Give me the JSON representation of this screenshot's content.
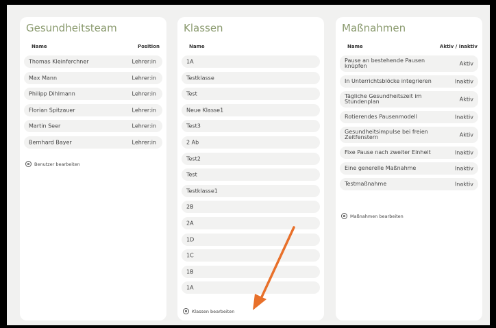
{
  "team": {
    "title": "Gesundheitsteam",
    "col_name": "Name",
    "col_position": "Position",
    "members": [
      {
        "name": "Thomas Kleinferchner",
        "position": "Lehrer:in"
      },
      {
        "name": "Max Mann",
        "position": "Lehrer:in"
      },
      {
        "name": "Philipp Dihlmann",
        "position": "Lehrer:in"
      },
      {
        "name": "Florian Spitzauer",
        "position": "Lehrer:in"
      },
      {
        "name": "Martin Seer",
        "position": "Lehrer:in"
      },
      {
        "name": "Bernhard Bayer",
        "position": "Lehrer:in"
      }
    ],
    "edit_label": "Benutzer bearbeiten"
  },
  "classes": {
    "title": "Klassen",
    "col_name": "Name",
    "items": [
      "1A",
      "Testklasse",
      "Test",
      "Neue Klasse1",
      "Test3",
      "2 Ab",
      "Test2",
      "Test",
      "Testklasse1",
      "2B",
      "2A",
      "1D",
      "1C",
      "1B",
      "1A"
    ],
    "edit_label": "Klassen bearbeiten"
  },
  "measures": {
    "title": "Maßnahmen",
    "col_name": "Name",
    "col_status": "Aktiv / Inaktiv",
    "items": [
      {
        "name": "Pause an bestehende Pausen knüpfen",
        "status": "Aktiv"
      },
      {
        "name": "In Unterrichtsblöcke integrieren",
        "status": "Inaktiv"
      },
      {
        "name": "Tägliche Gesundheitszeit im Stundenplan",
        "status": "Aktiv"
      },
      {
        "name": "Rotierendes Pausenmodell",
        "status": "Inaktiv"
      },
      {
        "name": "Gesundheitsimpulse bei freien Zeitfenstern",
        "status": "Aktiv"
      },
      {
        "name": "Fixe Pause nach zweiter Einheit",
        "status": "Inaktiv"
      },
      {
        "name": "Eine generelle Maßnahme",
        "status": "Inaktiv"
      },
      {
        "name": "Testmaßnahme",
        "status": "Inaktiv"
      }
    ],
    "edit_label": "Maßnahmen bearbeiten"
  },
  "colors": {
    "accent": "#8a9a6e",
    "arrow": "#e8702a",
    "row_bg": "#f2f2f1",
    "panel_bg": "#f1f1f0"
  }
}
